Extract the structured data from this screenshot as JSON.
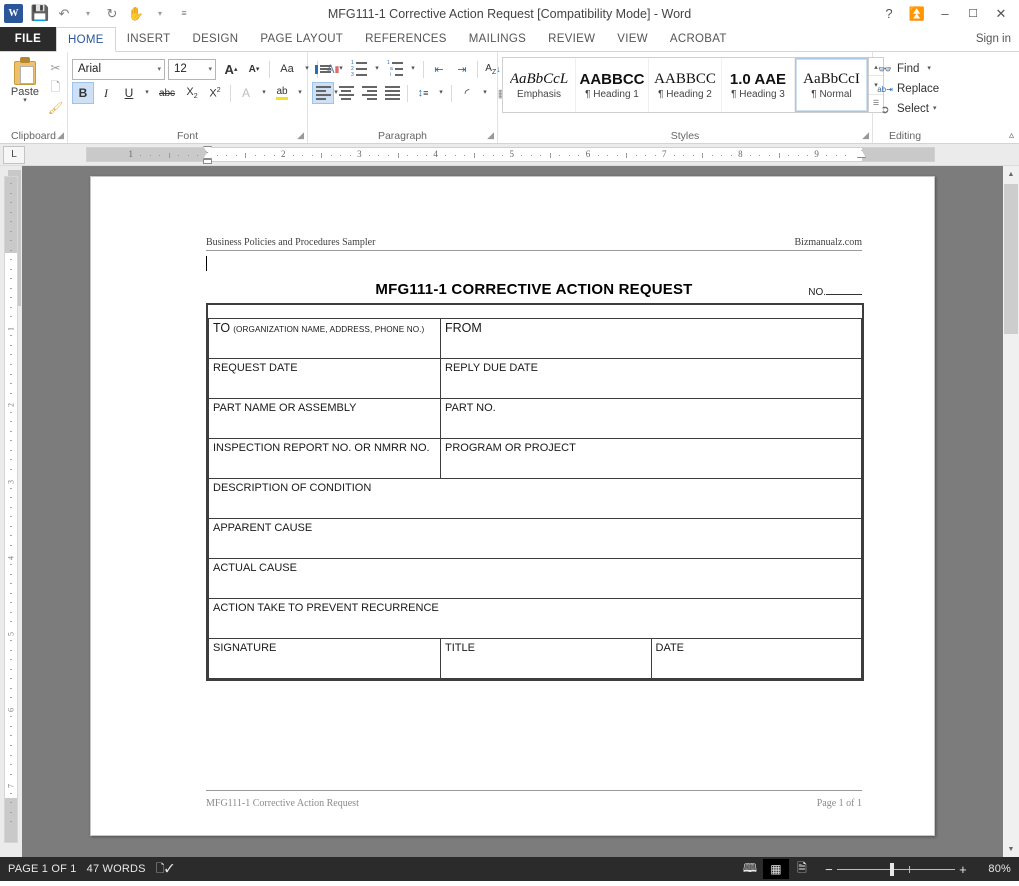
{
  "window": {
    "title": "MFG111-1 Corrective Action Request [Compatibility Mode] - Word",
    "help_icon": "?",
    "ribbon_display_icon": "ribbon-display-options",
    "minimize_icon": "–",
    "restore_icon": "❐",
    "close_icon": "✕",
    "signin": "Sign in"
  },
  "quick_access": {
    "logo": "W",
    "save_icon": "save-icon",
    "undo_icon": "↶",
    "redo_icon": "↻",
    "touch_icon": "touch-mode-icon",
    "customize_icon": "≡"
  },
  "tabs": [
    {
      "label": "FILE",
      "active": false
    },
    {
      "label": "HOME",
      "active": true
    },
    {
      "label": "INSERT",
      "active": false
    },
    {
      "label": "DESIGN",
      "active": false
    },
    {
      "label": "PAGE LAYOUT",
      "active": false
    },
    {
      "label": "REFERENCES",
      "active": false
    },
    {
      "label": "MAILINGS",
      "active": false
    },
    {
      "label": "REVIEW",
      "active": false
    },
    {
      "label": "VIEW",
      "active": false
    },
    {
      "label": "ACROBAT",
      "active": false
    }
  ],
  "ribbon": {
    "clipboard": {
      "label": "Clipboard",
      "paste_label": "Paste",
      "cut_icon": "✂",
      "copy_icon": "❐",
      "format_painter_icon": "format-painter-icon"
    },
    "font": {
      "label": "Font",
      "font_name": "Arial",
      "font_size": "12",
      "grow_font": "A",
      "shrink_font": "A",
      "change_case": "Aa",
      "clear_formatting": "A",
      "bold": "B",
      "italic": "I",
      "underline": "U",
      "strikethrough": "abc",
      "subscript": "X",
      "superscript": "X",
      "text_effects": "A",
      "highlight": "ab",
      "font_color": "A"
    },
    "paragraph": {
      "label": "Paragraph",
      "bullets_icon": "bullets-icon",
      "numbering_icon": "numbering-icon",
      "multilevel_icon": "multilevel-list-icon",
      "decrease_indent_icon": "decrease-indent-icon",
      "increase_indent_icon": "increase-indent-icon",
      "sort_icon": "A↓",
      "show_marks_icon": "¶",
      "align_left_icon": "align-left-icon",
      "align_center_icon": "align-center-icon",
      "align_right_icon": "align-right-icon",
      "justify_icon": "justify-icon",
      "line_spacing_icon": "line-spacing-icon",
      "shading_icon": "shading-icon",
      "borders_icon": "borders-icon"
    },
    "styles": {
      "label": "Styles",
      "items": [
        {
          "preview": "AaBbCcL",
          "name": "Emphasis",
          "selected": false
        },
        {
          "preview": "AABBCC",
          "name": "¶ Heading 1",
          "selected": false
        },
        {
          "preview": "AABBCC",
          "name": "¶ Heading 2",
          "selected": false
        },
        {
          "preview": "1.0  AAE",
          "name": "¶ Heading 3",
          "selected": false
        },
        {
          "preview": "AaBbCcI",
          "name": "¶ Normal",
          "selected": true
        }
      ],
      "scroll_up": "▴",
      "scroll_down": "▾",
      "more": "☰"
    },
    "editing": {
      "label": "Editing",
      "find": "Find",
      "replace": "Replace",
      "select": "Select",
      "find_icon": "binoculars-icon",
      "replace_icon": "replace-icon",
      "select_icon": "pointer-icon"
    },
    "collapse_icon": "⌃"
  },
  "ruler": {
    "tab_stop_selector": "L",
    "h_numbers": [
      "1",
      "1",
      "2",
      "3",
      "4",
      "5",
      "6",
      "7",
      "8",
      "9"
    ],
    "v_numbers": [
      "1",
      "2",
      "3",
      "4",
      "5",
      "6",
      "7"
    ]
  },
  "document": {
    "header_left": "Business Policies and Procedures Sampler",
    "header_right": "Bizmanualz.com",
    "title": "MFG111-1 CORRECTIVE ACTION REQUEST",
    "number_label": "NO.",
    "footer_left": "MFG111-1 Corrective Action Request",
    "footer_right": "Page 1 of 1",
    "form_rows": [
      {
        "cells": [
          {
            "label": "TO",
            "sub": "(ORGANIZATION NAME, ADDRESS, PHONE NO.)",
            "big": true
          },
          {
            "label": "FROM",
            "sub": "",
            "big": true
          }
        ]
      },
      {
        "cells": [
          {
            "label": "REQUEST DATE",
            "sub": "",
            "big": false
          },
          {
            "label": "REPLY DUE DATE",
            "sub": "",
            "big": false
          }
        ]
      },
      {
        "cells": [
          {
            "label": "PART NAME OR ASSEMBLY",
            "sub": "",
            "big": false
          },
          {
            "label": "PART NO.",
            "sub": "",
            "big": false
          }
        ]
      },
      {
        "cells": [
          {
            "label": "INSPECTION REPORT NO. OR NMRR NO.",
            "sub": "",
            "big": false
          },
          {
            "label": "PROGRAM OR PROJECT",
            "sub": "",
            "big": false
          }
        ]
      },
      {
        "cells": [
          {
            "label": "DESCRIPTION OF CONDITION",
            "sub": "",
            "big": false
          }
        ]
      },
      {
        "cells": [
          {
            "label": "APPARENT CAUSE",
            "sub": "",
            "big": false
          }
        ]
      },
      {
        "cells": [
          {
            "label": "ACTUAL CAUSE",
            "sub": "",
            "big": false
          }
        ]
      },
      {
        "cells": [
          {
            "label": "ACTION TAKE TO PREVENT RECURRENCE",
            "sub": "",
            "big": false
          }
        ]
      },
      {
        "cells": [
          {
            "label": "SIGNATURE",
            "sub": "",
            "big": false
          },
          {
            "label": "TITLE",
            "sub": "",
            "big": false
          },
          {
            "label": "DATE",
            "sub": "",
            "big": false
          }
        ]
      }
    ]
  },
  "status": {
    "page": "PAGE 1 OF 1",
    "words": "47 WORDS",
    "proofing_icon": "proofing-errors-icon",
    "read_mode_icon": "read-mode-icon",
    "print_layout_icon": "print-layout-icon",
    "web_layout_icon": "web-layout-icon",
    "zoom_out": "−",
    "zoom_in": "+",
    "zoom_level": "80%"
  }
}
